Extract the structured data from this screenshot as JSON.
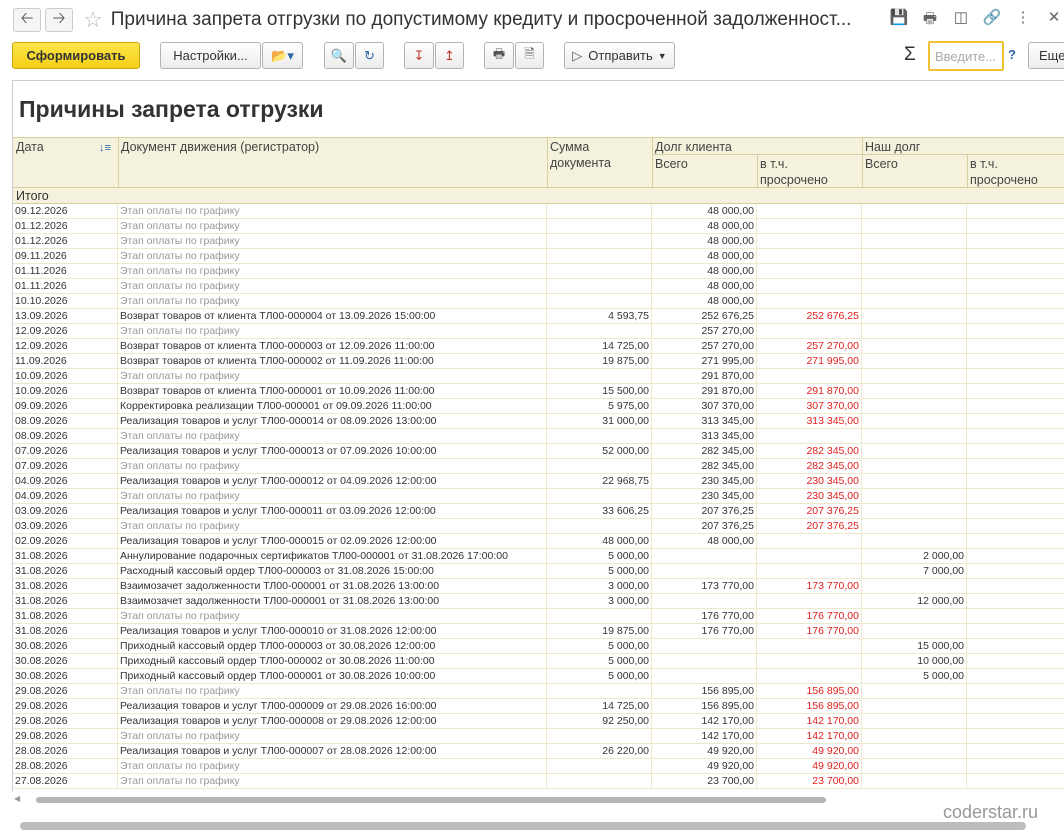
{
  "window": {
    "title": "Причина запрета отгрузки по допустимому кредиту и просроченной задолженност..."
  },
  "toolbar": {
    "generate": "Сформировать",
    "settings": "Настройки...",
    "send": "Отправить",
    "search_placeholder": "Введите...",
    "help": "?",
    "more": "Еще"
  },
  "report": {
    "title": "Причины запрета отгрузки"
  },
  "columns": {
    "date": "Дата",
    "doc": "Документ движения (регистратор)",
    "sum": "Сумма документа",
    "client_debt": "Долг клиента",
    "total": "Всего",
    "overdue": "в т.ч. просрочено",
    "our_debt": "Наш долг",
    "total2": "Всего",
    "overdue2": "в т.ч. просрочено",
    "itogo": "Итого"
  },
  "rows": [
    {
      "date": "09.12.2026",
      "doc": "Этап оплаты по графику",
      "sum": "",
      "ct": "48 000,00",
      "co": "",
      "ot": "",
      "oo": "",
      "g": true
    },
    {
      "date": "01.12.2026",
      "doc": "Этап оплаты по графику",
      "sum": "",
      "ct": "48 000,00",
      "co": "",
      "ot": "",
      "oo": "",
      "g": true
    },
    {
      "date": "01.12.2026",
      "doc": "Этап оплаты по графику",
      "sum": "",
      "ct": "48 000,00",
      "co": "",
      "ot": "",
      "oo": "",
      "g": true
    },
    {
      "date": "09.11.2026",
      "doc": "Этап оплаты по графику",
      "sum": "",
      "ct": "48 000,00",
      "co": "",
      "ot": "",
      "oo": "",
      "g": true
    },
    {
      "date": "01.11.2026",
      "doc": "Этап оплаты по графику",
      "sum": "",
      "ct": "48 000,00",
      "co": "",
      "ot": "",
      "oo": "",
      "g": true
    },
    {
      "date": "01.11.2026",
      "doc": "Этап оплаты по графику",
      "sum": "",
      "ct": "48 000,00",
      "co": "",
      "ot": "",
      "oo": "",
      "g": true
    },
    {
      "date": "10.10.2026",
      "doc": "Этап оплаты по графику",
      "sum": "",
      "ct": "48 000,00",
      "co": "",
      "ot": "",
      "oo": "",
      "g": true
    },
    {
      "date": "13.09.2026",
      "doc": "Возврат товаров от клиента ТЛ00-000004 от 13.09.2026 15:00:00",
      "sum": "4 593,75",
      "ct": "252 676,25",
      "co": "252 676,25",
      "ot": "",
      "oo": "",
      "g": false
    },
    {
      "date": "12.09.2026",
      "doc": "Этап оплаты по графику",
      "sum": "",
      "ct": "257 270,00",
      "co": "",
      "ot": "",
      "oo": "",
      "g": true
    },
    {
      "date": "12.09.2026",
      "doc": "Возврат товаров от клиента ТЛ00-000003 от 12.09.2026 11:00:00",
      "sum": "14 725,00",
      "ct": "257 270,00",
      "co": "257 270,00",
      "ot": "",
      "oo": "",
      "g": false
    },
    {
      "date": "11.09.2026",
      "doc": "Возврат товаров от клиента ТЛ00-000002 от 11.09.2026 11:00:00",
      "sum": "19 875,00",
      "ct": "271 995,00",
      "co": "271 995,00",
      "ot": "",
      "oo": "",
      "g": false
    },
    {
      "date": "10.09.2026",
      "doc": "Этап оплаты по графику",
      "sum": "",
      "ct": "291 870,00",
      "co": "",
      "ot": "",
      "oo": "",
      "g": true
    },
    {
      "date": "10.09.2026",
      "doc": "Возврат товаров от клиента ТЛ00-000001 от 10.09.2026 11:00:00",
      "sum": "15 500,00",
      "ct": "291 870,00",
      "co": "291 870,00",
      "ot": "",
      "oo": "",
      "g": false
    },
    {
      "date": "09.09.2026",
      "doc": "Корректировка реализации ТЛ00-000001 от 09.09.2026 11:00:00",
      "sum": "5 975,00",
      "ct": "307 370,00",
      "co": "307 370,00",
      "ot": "",
      "oo": "",
      "g": false
    },
    {
      "date": "08.09.2026",
      "doc": "Реализация товаров и услуг ТЛ00-000014 от 08.09.2026 13:00:00",
      "sum": "31 000,00",
      "ct": "313 345,00",
      "co": "313 345,00",
      "ot": "",
      "oo": "",
      "g": false
    },
    {
      "date": "08.09.2026",
      "doc": "Этап оплаты по графику",
      "sum": "",
      "ct": "313 345,00",
      "co": "",
      "ot": "",
      "oo": "",
      "g": true
    },
    {
      "date": "07.09.2026",
      "doc": "Реализация товаров и услуг ТЛ00-000013 от 07.09.2026 10:00:00",
      "sum": "52 000,00",
      "ct": "282 345,00",
      "co": "282 345,00",
      "ot": "",
      "oo": "",
      "g": false
    },
    {
      "date": "07.09.2026",
      "doc": "Этап оплаты по графику",
      "sum": "",
      "ct": "282 345,00",
      "co": "282 345,00",
      "ot": "",
      "oo": "",
      "g": true
    },
    {
      "date": "04.09.2026",
      "doc": "Реализация товаров и услуг ТЛ00-000012 от 04.09.2026 12:00:00",
      "sum": "22 968,75",
      "ct": "230 345,00",
      "co": "230 345,00",
      "ot": "",
      "oo": "",
      "g": false
    },
    {
      "date": "04.09.2026",
      "doc": "Этап оплаты по графику",
      "sum": "",
      "ct": "230 345,00",
      "co": "230 345,00",
      "ot": "",
      "oo": "",
      "g": true
    },
    {
      "date": "03.09.2026",
      "doc": "Реализация товаров и услуг ТЛ00-000011 от 03.09.2026 12:00:00",
      "sum": "33 606,25",
      "ct": "207 376,25",
      "co": "207 376,25",
      "ot": "",
      "oo": "",
      "g": false
    },
    {
      "date": "03.09.2026",
      "doc": "Этап оплаты по графику",
      "sum": "",
      "ct": "207 376,25",
      "co": "207 376,25",
      "ot": "",
      "oo": "",
      "g": true
    },
    {
      "date": "02.09.2026",
      "doc": "Реализация товаров и услуг ТЛ00-000015 от 02.09.2026 12:00:00",
      "sum": "48 000,00",
      "ct": "48 000,00",
      "co": "",
      "ot": "",
      "oo": "",
      "g": false
    },
    {
      "date": "31.08.2026",
      "doc": "Аннулирование подарочных сертификатов ТЛ00-000001 от 31.08.2026 17:00:00",
      "sum": "5 000,00",
      "ct": "",
      "co": "",
      "ot": "2 000,00",
      "oo": "",
      "g": false
    },
    {
      "date": "31.08.2026",
      "doc": "Расходный кассовый ордер ТЛ00-000003 от 31.08.2026 15:00:00",
      "sum": "5 000,00",
      "ct": "",
      "co": "",
      "ot": "7 000,00",
      "oo": "",
      "g": false
    },
    {
      "date": "31.08.2026",
      "doc": "Взаимозачет задолженности ТЛ00-000001 от 31.08.2026 13:00:00",
      "sum": "3 000,00",
      "ct": "173 770,00",
      "co": "173 770,00",
      "ot": "",
      "oo": "",
      "g": false
    },
    {
      "date": "31.08.2026",
      "doc": "Взаимозачет задолженности ТЛ00-000001 от 31.08.2026 13:00:00",
      "sum": "3 000,00",
      "ct": "",
      "co": "",
      "ot": "12 000,00",
      "oo": "",
      "g": false
    },
    {
      "date": "31.08.2026",
      "doc": "Этап оплаты по графику",
      "sum": "",
      "ct": "176 770,00",
      "co": "176 770,00",
      "ot": "",
      "oo": "",
      "g": true
    },
    {
      "date": "31.08.2026",
      "doc": "Реализация товаров и услуг ТЛ00-000010 от 31.08.2026 12:00:00",
      "sum": "19 875,00",
      "ct": "176 770,00",
      "co": "176 770,00",
      "ot": "",
      "oo": "",
      "g": false
    },
    {
      "date": "30.08.2026",
      "doc": "Приходный кассовый ордер ТЛ00-000003 от 30.08.2026 12:00:00",
      "sum": "5 000,00",
      "ct": "",
      "co": "",
      "ot": "15 000,00",
      "oo": "",
      "g": false
    },
    {
      "date": "30.08.2026",
      "doc": "Приходный кассовый ордер ТЛ00-000002 от 30.08.2026 11:00:00",
      "sum": "5 000,00",
      "ct": "",
      "co": "",
      "ot": "10 000,00",
      "oo": "",
      "g": false
    },
    {
      "date": "30.08.2026",
      "doc": "Приходный кассовый ордер ТЛ00-000001 от 30.08.2026 10:00:00",
      "sum": "5 000,00",
      "ct": "",
      "co": "",
      "ot": "5 000,00",
      "oo": "",
      "g": false
    },
    {
      "date": "29.08.2026",
      "doc": "Этап оплаты по графику",
      "sum": "",
      "ct": "156 895,00",
      "co": "156 895,00",
      "ot": "",
      "oo": "",
      "g": true
    },
    {
      "date": "29.08.2026",
      "doc": "Реализация товаров и услуг ТЛ00-000009 от 29.08.2026 16:00:00",
      "sum": "14 725,00",
      "ct": "156 895,00",
      "co": "156 895,00",
      "ot": "",
      "oo": "",
      "g": false
    },
    {
      "date": "29.08.2026",
      "doc": "Реализация товаров и услуг ТЛ00-000008 от 29.08.2026 12:00:00",
      "sum": "92 250,00",
      "ct": "142 170,00",
      "co": "142 170,00",
      "ot": "",
      "oo": "",
      "g": false
    },
    {
      "date": "29.08.2026",
      "doc": "Этап оплаты по графику",
      "sum": "",
      "ct": "142 170,00",
      "co": "142 170,00",
      "ot": "",
      "oo": "",
      "g": true
    },
    {
      "date": "28.08.2026",
      "doc": "Реализация товаров и услуг ТЛ00-000007 от 28.08.2026 12:00:00",
      "sum": "26 220,00",
      "ct": "49 920,00",
      "co": "49 920,00",
      "ot": "",
      "oo": "",
      "g": false
    },
    {
      "date": "28.08.2026",
      "doc": "Этап оплаты по графику",
      "sum": "",
      "ct": "49 920,00",
      "co": "49 920,00",
      "ot": "",
      "oo": "",
      "g": true
    },
    {
      "date": "27.08.2026",
      "doc": "Этап оплаты по графику",
      "sum": "",
      "ct": "23 700,00",
      "co": "23 700,00",
      "ot": "",
      "oo": "",
      "g": true
    }
  ],
  "footer": {
    "brand": "coderstar.ru"
  }
}
